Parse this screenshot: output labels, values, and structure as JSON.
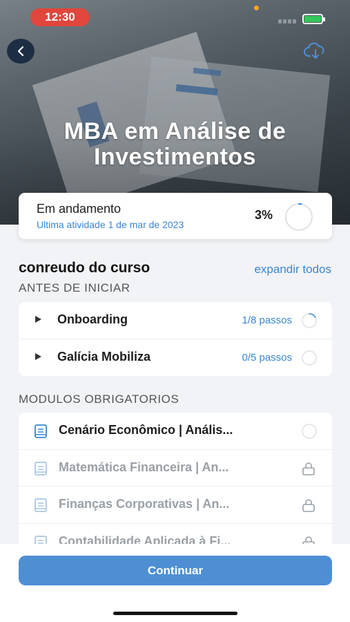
{
  "status_bar": {
    "time": "12:30",
    "battery_color": "#34c759"
  },
  "hero": {
    "title_line1": "MBA em Análise de",
    "title_line2": "Investimentos",
    "back_icon": "chevron-left-icon",
    "download_icon": "cloud-download-icon"
  },
  "progress": {
    "status": "Em andamento",
    "last_activity": "Ultima atividade 1 de mar de 2023",
    "percent_label": "3%",
    "percent_value": 0.03
  },
  "content": {
    "title": "conreudo do curso",
    "expand_all": "expandir todos"
  },
  "before_start": {
    "label": "ANTES DE INICIAR",
    "items": [
      {
        "label": "Onboarding",
        "steps": "1/8 passos"
      },
      {
        "label": "Galícia Mobiliza",
        "steps": "0/5 passos"
      }
    ]
  },
  "modules": {
    "label": "MODULOS OBRIGATORIOS",
    "items": [
      {
        "label": "Cenário Econômico | Anális...",
        "locked": false
      },
      {
        "label": "Matemática Financeira | An...",
        "locked": true
      },
      {
        "label": "Finanças Corporativas | An...",
        "locked": true
      },
      {
        "label": "Contabilidade Aplicada à Fi...",
        "locked": true
      }
    ]
  },
  "footer": {
    "continue_label": "Continuar"
  },
  "colors": {
    "accent": "#3a86d1",
    "button": "#4e8fd4",
    "status_pill": "#e0463c"
  }
}
